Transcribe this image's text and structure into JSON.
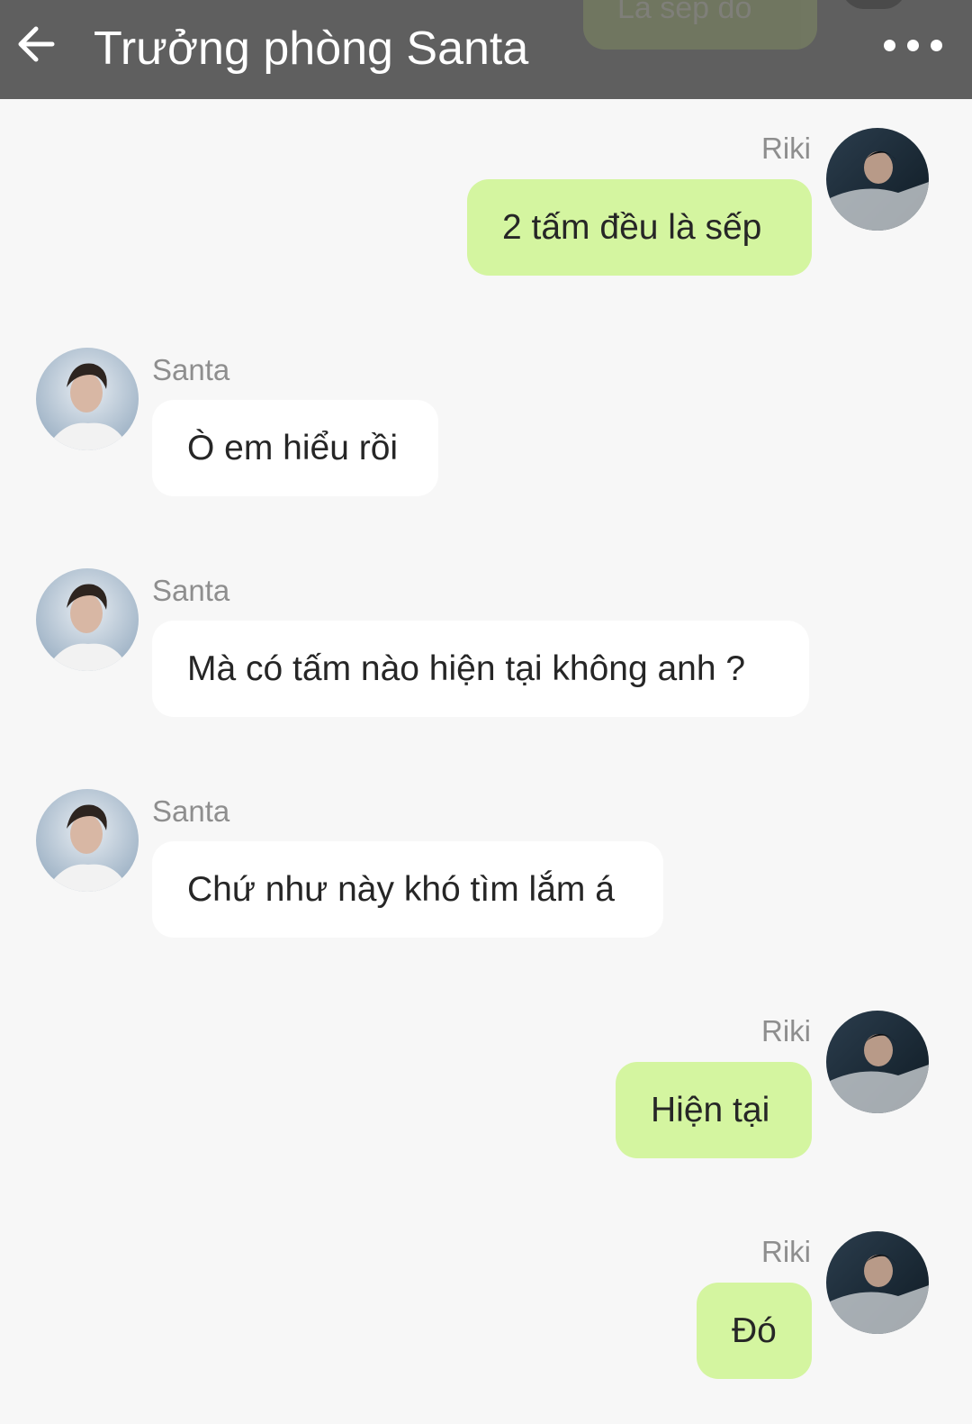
{
  "header": {
    "title": "Trưởng phòng Santa",
    "back_icon": "arrow-left-icon",
    "more_icon": "more-horizontal-icon",
    "background": "#5f5f5f",
    "partial_bubble_text": "Là sếp đó"
  },
  "colors": {
    "outgoing_bubble": "#d4f5a0",
    "incoming_bubble": "#ffffff",
    "sender_name": "#8e8e8e",
    "chat_background": "#f7f7f7"
  },
  "messages": [
    {
      "sender": "Riki",
      "direction": "outgoing",
      "text": "2 tấm đều là sếp"
    },
    {
      "sender": "Santa",
      "direction": "incoming",
      "text": "Ò em hiểu rồi"
    },
    {
      "sender": "Santa",
      "direction": "incoming",
      "text": "Mà có tấm nào hiện tại không anh ?"
    },
    {
      "sender": "Santa",
      "direction": "incoming",
      "text": "Chứ như này khó tìm lắm á"
    },
    {
      "sender": "Riki",
      "direction": "outgoing",
      "text": "Hiện tại"
    },
    {
      "sender": "Riki",
      "direction": "outgoing",
      "text": "Đó"
    }
  ]
}
